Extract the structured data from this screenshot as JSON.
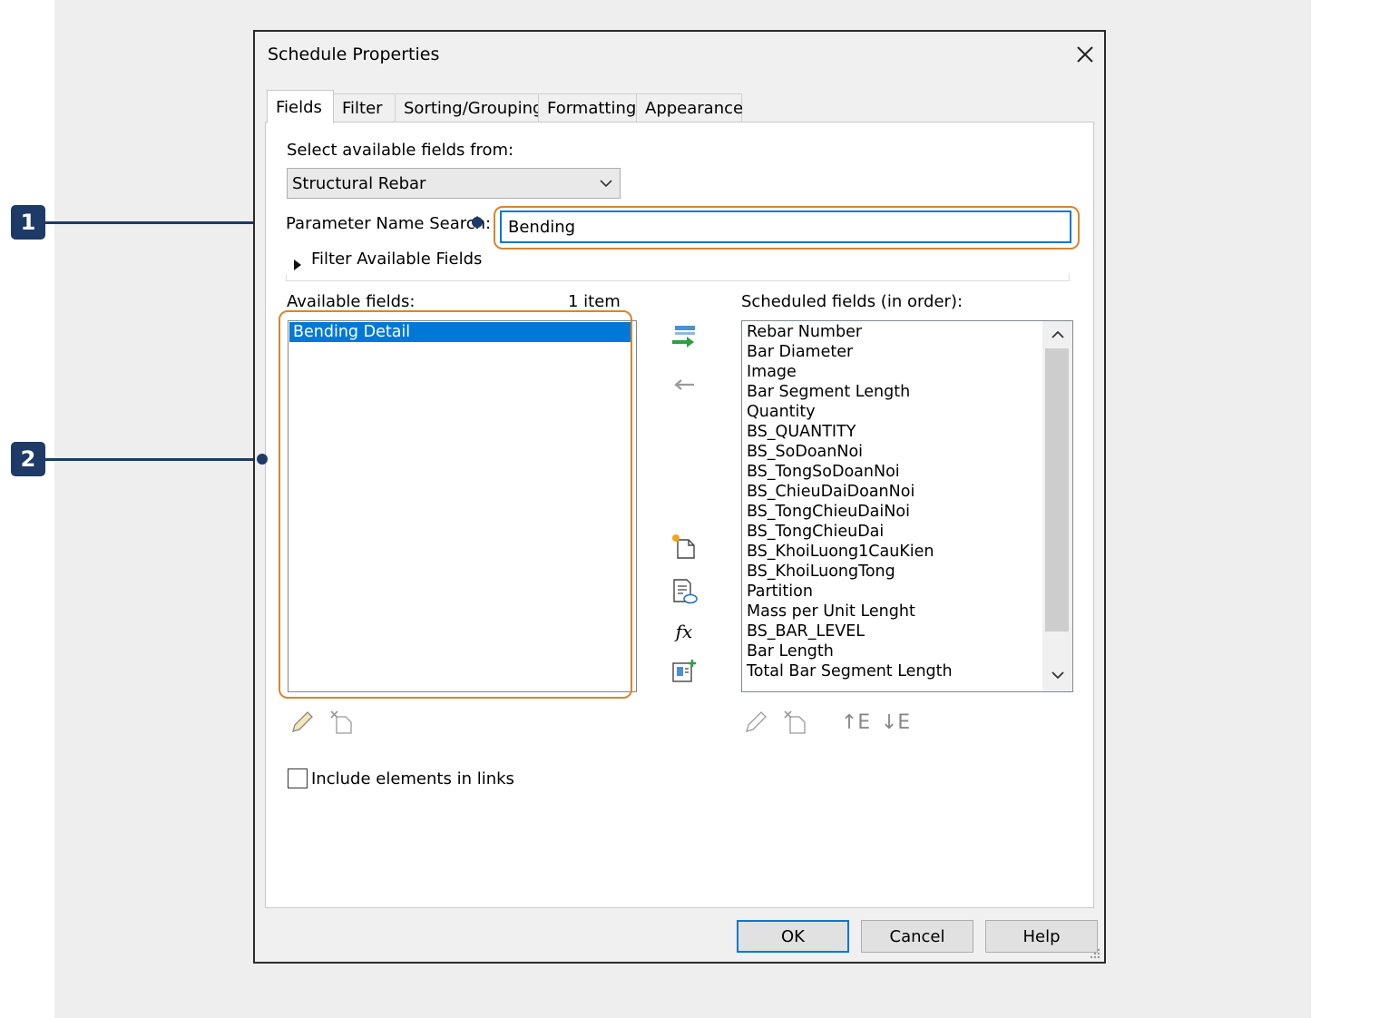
{
  "dialog": {
    "title": "Schedule Properties"
  },
  "tabs": [
    "Fields",
    "Filter",
    "Sorting/Grouping",
    "Formatting",
    "Appearance"
  ],
  "fields_tab": {
    "select_from_label": "Select available fields from:",
    "category_value": "Structural Rebar",
    "search_label": "Parameter Name Search:",
    "search_value": "Bending",
    "filter_toggle_label": "Filter Available Fields",
    "available_label": "Available fields:",
    "available_count": "1 item",
    "available_items": [
      "Bending Detail"
    ],
    "scheduled_label": "Scheduled fields (in order):",
    "scheduled_items": [
      "Rebar Number",
      "Bar Diameter",
      "Image",
      "Bar Segment Length",
      "Quantity",
      "BS_QUANTITY",
      "BS_SoDoanNoi",
      "BS_TongSoDoanNoi",
      "BS_ChieuDaiDoanNoi",
      "BS_TongChieuDaiNoi",
      "BS_TongChieuDai",
      "BS_KhoiLuong1CauKien",
      "BS_KhoiLuongTong",
      "Partition",
      "Mass per Unit Lenght",
      "BS_BAR_LEVEL",
      "Bar Length",
      "Total Bar Segment Length"
    ],
    "include_links_label": "Include elements in links"
  },
  "buttons": {
    "ok": "OK",
    "cancel": "Cancel",
    "help": "Help"
  },
  "callouts": [
    "1",
    "2"
  ],
  "icons": {
    "fx_glyph": "fx",
    "move_up_glyph": "↑E",
    "move_down_glyph": "↓E"
  },
  "colors": {
    "accent": "#0078d7",
    "highlight": "#d4872f",
    "callout": "#1e3a66"
  }
}
